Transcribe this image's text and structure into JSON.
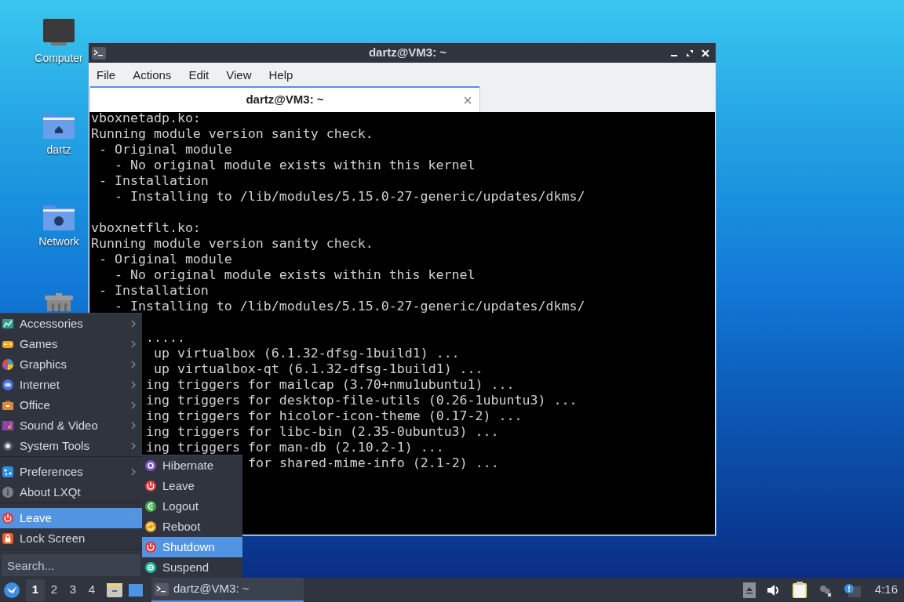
{
  "desktop_icons": [
    {
      "label": "Computer",
      "kind": "computer"
    },
    {
      "label": "dartz",
      "kind": "home"
    },
    {
      "label": "Network",
      "kind": "network"
    },
    {
      "kind": "trash"
    }
  ],
  "window": {
    "title": "dartz@VM3: ~",
    "menu": [
      "File",
      "Actions",
      "Edit",
      "View",
      "Help"
    ],
    "tabs": [
      {
        "label": "dartz@VM3: ~",
        "selected": true
      }
    ],
    "terminal_lines": [
      {
        "text": "vboxnetadp.ko:",
        "kind": "full"
      },
      {
        "text": "Running module version sanity check.",
        "kind": "full"
      },
      {
        "text": " - Original module",
        "kind": "full"
      },
      {
        "text": "   - No original module exists within this kernel",
        "kind": "full"
      },
      {
        "text": " - Installation",
        "kind": "full"
      },
      {
        "text": "   - Installing to /lib/modules/5.15.0-27-generic/updates/dkms/",
        "kind": "full"
      },
      {
        "kind": "blank"
      },
      {
        "text": "vboxnetflt.ko:",
        "kind": "full"
      },
      {
        "text": "Running module version sanity check.",
        "kind": "full"
      },
      {
        "text": " - Original module",
        "kind": "full"
      },
      {
        "text": "   - No original module exists within this kernel",
        "kind": "full"
      },
      {
        "text": " - Installation",
        "kind": "full"
      },
      {
        "text": "   - Installing to /lib/modules/5.15.0-27-generic/updates/dkms/",
        "kind": "full"
      },
      {
        "kind": "blank"
      },
      {
        "text": ".....",
        "kind": "behind_menu"
      },
      {
        "text": " up virtualbox (6.1.32-dfsg-1build1) ...",
        "kind": "behind_menu"
      },
      {
        "text": " up virtualbox-qt (6.1.32-dfsg-1build1) ...",
        "kind": "behind_menu"
      },
      {
        "text": "ing triggers for mailcap (3.70+nmu1ubuntu1) ...",
        "kind": "behind_menu"
      },
      {
        "text": "ing triggers for desktop-file-utils (0.26-1ubuntu3) ...",
        "kind": "behind_menu"
      },
      {
        "text": "ing triggers for hicolor-icon-theme (0.17-2) ...",
        "kind": "behind_menu"
      },
      {
        "text": "ing triggers for libc-bin (2.35-0ubuntu3) ...",
        "kind": "behind_menu"
      },
      {
        "text": "ing triggers for man-db (2.10.2-1) ...",
        "kind": "behind_menu"
      },
      {
        "text": "for shared-mime-info (2.1-2) ...",
        "kind": "behind_submenu"
      }
    ]
  },
  "app_menu": {
    "sections": [
      [
        {
          "label": "Accessories",
          "kind": "accessories",
          "submenu": true,
          "selected": false
        },
        {
          "label": "Games",
          "kind": "games",
          "submenu": true,
          "selected": false
        },
        {
          "label": "Graphics",
          "kind": "graphics",
          "submenu": true,
          "selected": false
        },
        {
          "label": "Internet",
          "kind": "internet",
          "submenu": true,
          "selected": false
        },
        {
          "label": "Office",
          "kind": "office",
          "submenu": true,
          "selected": false
        },
        {
          "label": "Sound & Video",
          "kind": "sound",
          "submenu": true,
          "selected": false
        },
        {
          "label": "System Tools",
          "kind": "system",
          "submenu": true,
          "selected": false
        }
      ],
      [
        {
          "label": "Preferences",
          "kind": "preferences",
          "submenu": true,
          "selected": false
        },
        {
          "label": "About LXQt",
          "kind": "about",
          "submenu": false,
          "selected": false
        }
      ],
      [
        {
          "label": "Leave",
          "kind": "power",
          "submenu": true,
          "selected": true
        },
        {
          "label": "Lock Screen",
          "kind": "lock",
          "submenu": false,
          "selected": false
        }
      ]
    ],
    "search": {
      "placeholder": "Search..."
    }
  },
  "leave_submenu": [
    {
      "label": "Hibernate",
      "kind": "hibernate",
      "selected": false
    },
    {
      "label": "Leave",
      "kind": "power",
      "selected": false
    },
    {
      "label": "Logout",
      "kind": "logout",
      "selected": false
    },
    {
      "label": "Reboot",
      "kind": "reboot",
      "selected": false
    },
    {
      "label": "Shutdown",
      "kind": "power",
      "selected": true
    },
    {
      "label": "Suspend",
      "kind": "suspend",
      "selected": false
    }
  ],
  "taskbar": {
    "desktops": [
      {
        "label": "1",
        "selected": true
      },
      {
        "label": "2",
        "selected": false
      },
      {
        "label": "3",
        "selected": false
      },
      {
        "label": "4",
        "selected": false
      }
    ],
    "tasks": [
      {
        "label": "dartz@VM3: ~",
        "selected": true
      }
    ],
    "clock": "4:16"
  }
}
